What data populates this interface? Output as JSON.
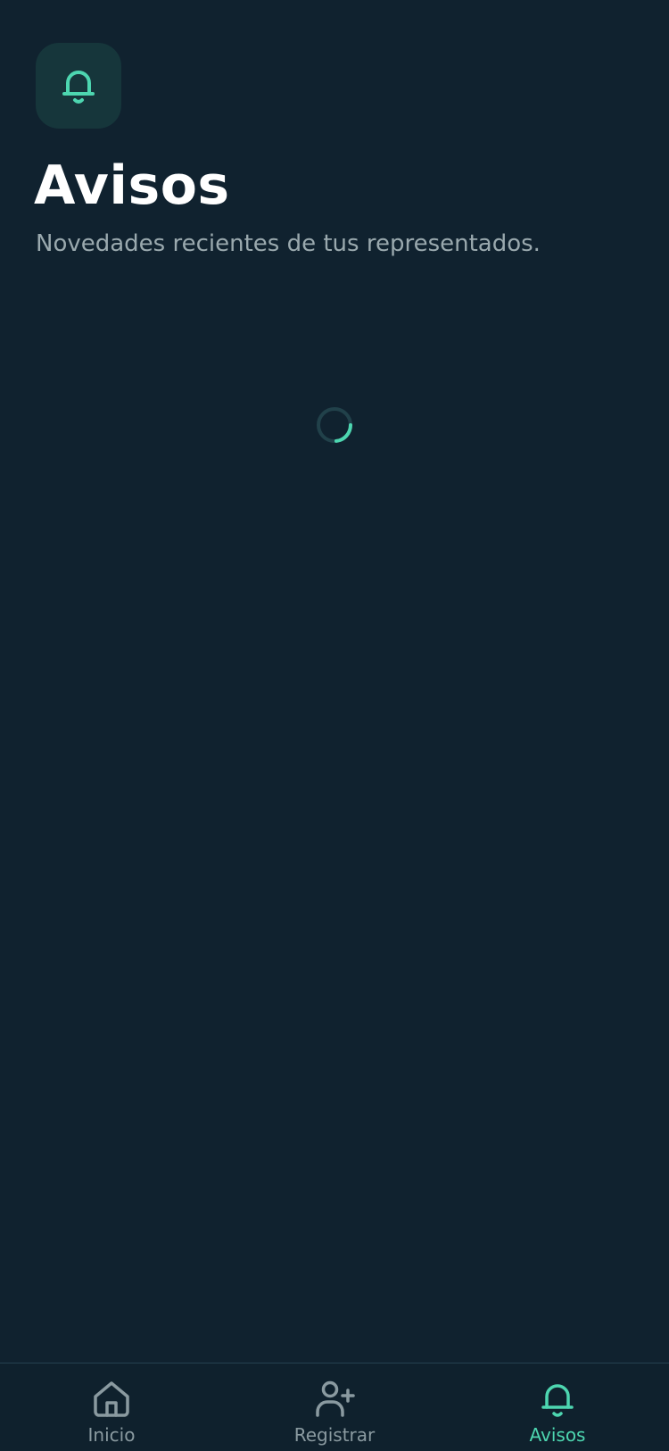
{
  "colors": {
    "background": "#10222f",
    "accent": "#4dd6b0",
    "icon_tile": "#16363b",
    "inactive": "#8a9aa0"
  },
  "header": {
    "icon": "bell-icon",
    "title": "Avisos",
    "subtitle": "Novedades recientes de tus representados."
  },
  "content": {
    "state": "loading",
    "spinner_icon": "loading-spinner"
  },
  "tab_bar": {
    "tabs": [
      {
        "label": "Inicio",
        "icon": "home-icon",
        "active": false
      },
      {
        "label": "Registrar",
        "icon": "user-plus-icon",
        "active": false
      },
      {
        "label": "Avisos",
        "icon": "bell-icon",
        "active": true
      }
    ]
  }
}
